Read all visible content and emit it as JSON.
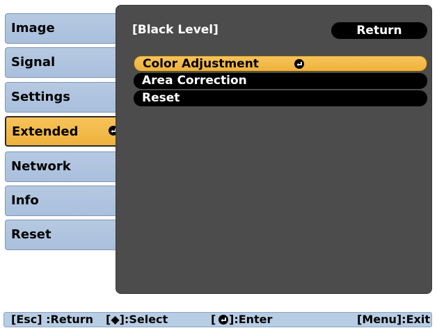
{
  "sidebar": {
    "items": [
      {
        "label": "Image"
      },
      {
        "label": "Signal"
      },
      {
        "label": "Settings"
      },
      {
        "label": "Extended"
      },
      {
        "label": "Network"
      },
      {
        "label": "Info"
      },
      {
        "label": "Reset"
      }
    ]
  },
  "panel": {
    "title": "[Black Level]",
    "return_label": "Return",
    "menu": [
      {
        "label": "Color Adjustment"
      },
      {
        "label": "Area Correction"
      },
      {
        "label": "Reset"
      }
    ]
  },
  "footer": {
    "esc_hint": "[Esc] :Return",
    "select_hint": "[◆]:Select",
    "enter_hint": "[",
    "enter_hint_suffix": "]:Enter",
    "menu_hint": "[Menu]:Exit"
  },
  "colors": {
    "sidebar_bg": "#b6c9e2",
    "highlight": "#f6c35a",
    "panel_bg": "#4c4c4c",
    "footer_bg": "#b7cde4"
  }
}
